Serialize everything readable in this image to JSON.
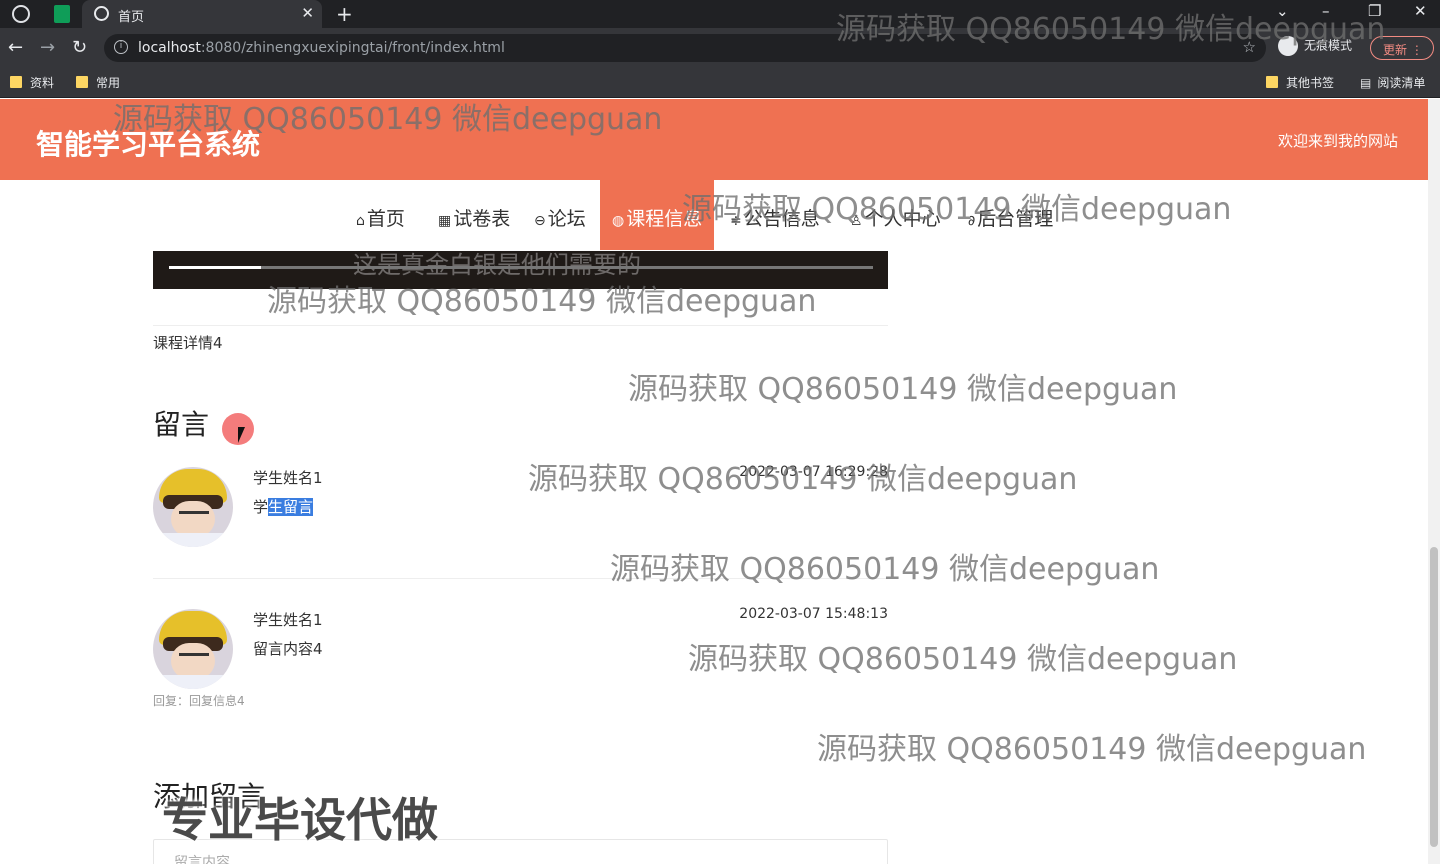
{
  "browser": {
    "tab_title": "首页",
    "url_host": "localhost",
    "url_path": ":8080/zhinengxuexipingtai/front/index.html",
    "incognito_label": "无痕模式",
    "update_label": "更新",
    "bookmarks": [
      "资料",
      "常用"
    ],
    "bookmarks_right": [
      "其他书签",
      "阅读清单"
    ]
  },
  "site": {
    "title": "智能学习平台系统",
    "welcome": "欢迎来到我的网站",
    "nav": [
      {
        "label": "首页",
        "icon": "home-icon"
      },
      {
        "label": "试卷表",
        "icon": "grid-icon"
      },
      {
        "label": "论坛",
        "icon": "chat-icon"
      },
      {
        "label": "课程信息",
        "icon": "globe-icon",
        "active": true
      },
      {
        "label": "公告信息",
        "icon": "announce-icon"
      },
      {
        "label": "个人中心",
        "icon": "user-icon"
      },
      {
        "label": "后台管理",
        "icon": "link-icon"
      }
    ],
    "accent_color": "#ef7152"
  },
  "video": {
    "subtitle": "这是真金白银是他们需要的",
    "progress": 0.13
  },
  "course": {
    "detail": "课程详情4"
  },
  "comments_section": {
    "title": "留言",
    "items": [
      {
        "name": "学生姓名1",
        "text_prefix": "学",
        "text_selected": "生留言",
        "time": "2022-03-07 16:29:28",
        "reply": ""
      },
      {
        "name": "学生姓名1",
        "text_prefix": "留言内容4",
        "text_selected": "",
        "time": "2022-03-07 15:48:13",
        "reply": "回复：回复信息4"
      }
    ]
  },
  "add_comment": {
    "title": "添加留言",
    "placeholder": "留言内容"
  },
  "watermark": "源码获取 QQ86050149 微信deepguan",
  "watermark_big": "专业毕设代做"
}
